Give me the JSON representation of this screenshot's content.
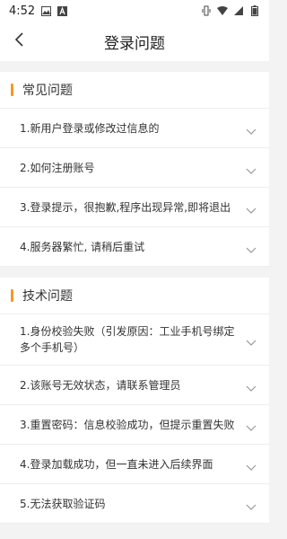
{
  "status_bar": {
    "time": "4:52",
    "icons": [
      "image-icon",
      "a-text-icon",
      "vibrate-icon",
      "wifi-icon",
      "signal-icon",
      "battery-icon"
    ]
  },
  "header": {
    "title": "登录问题",
    "back_icon": "chevron-left-icon"
  },
  "sections": [
    {
      "title": "常见问题",
      "items": [
        {
          "label": "1.新用户登录或修改过信息的"
        },
        {
          "label": "2.如何注册账号"
        },
        {
          "label": "3.登录提示，很抱歉,程序出现异常,即将退出"
        },
        {
          "label": "4.服务器繁忙, 请稍后重试"
        }
      ]
    },
    {
      "title": "技术问题",
      "items": [
        {
          "label": "1.身份校验失败（引发原因：工业手机号绑定多个手机号）"
        },
        {
          "label": "2.该账号无效状态，请联系管理员"
        },
        {
          "label": "3.重置密码：信息校验成功，但提示重置失败"
        },
        {
          "label": "4.登录加载成功，但一直未进入后续界面"
        },
        {
          "label": "5.无法获取验证码"
        }
      ]
    }
  ],
  "colors": {
    "accent": "#f39a25",
    "background": "#f3f3f3",
    "divider": "#eeeeee"
  }
}
